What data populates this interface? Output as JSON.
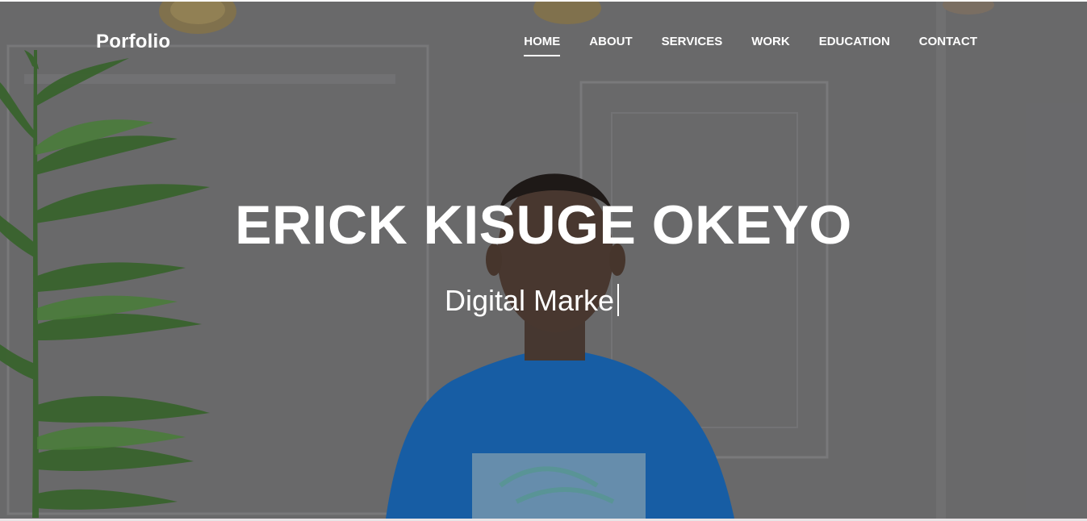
{
  "brand": "Porfolio",
  "nav": {
    "items": [
      {
        "label": "HOME",
        "active": true
      },
      {
        "label": "ABOUT",
        "active": false
      },
      {
        "label": "SERVICES",
        "active": false
      },
      {
        "label": "WORK",
        "active": false
      },
      {
        "label": "EDUCATION",
        "active": false
      },
      {
        "label": "CONTACT",
        "active": false
      }
    ]
  },
  "hero": {
    "name": "ERICK KISUGE OKEYO",
    "role_typed": "Digital Marke"
  },
  "colors": {
    "overlay": "#6f6f71",
    "text": "#ffffff",
    "shirt": "#1565b5",
    "plant": "#2f6b2a"
  }
}
